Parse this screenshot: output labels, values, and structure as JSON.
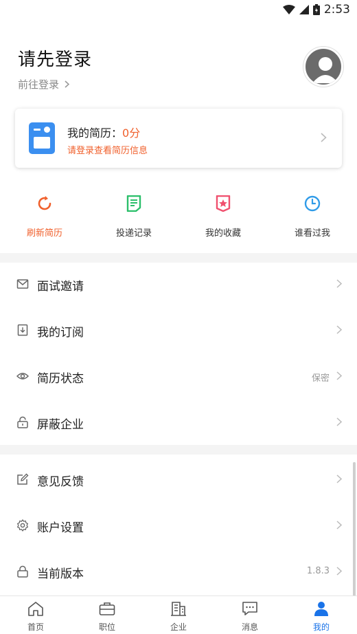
{
  "status": {
    "time": "2:53"
  },
  "profile": {
    "title": "请先登录",
    "login_link": "前往登录"
  },
  "resume": {
    "label": "我的简历：",
    "score": "0分",
    "hint": "请登录查看简历信息"
  },
  "quick_actions": [
    {
      "label": "刷新简历",
      "icon": "refresh-icon",
      "color": "#f0602c"
    },
    {
      "label": "投递记录",
      "icon": "document-icon",
      "color": "#2bbf6a"
    },
    {
      "label": "我的收藏",
      "icon": "bookmark-star-icon",
      "color": "#f0506e"
    },
    {
      "label": "谁看过我",
      "icon": "clock-icon",
      "color": "#2f9be8"
    }
  ],
  "menu_group1": [
    {
      "label": "面试邀请",
      "icon": "mail-icon",
      "value": ""
    },
    {
      "label": "我的订阅",
      "icon": "bookmark-icon",
      "value": ""
    },
    {
      "label": "简历状态",
      "icon": "eye-icon",
      "value": "保密"
    },
    {
      "label": "屏蔽企业",
      "icon": "unlock-icon",
      "value": ""
    }
  ],
  "menu_group2": [
    {
      "label": "意见反馈",
      "icon": "edit-icon",
      "value": ""
    },
    {
      "label": "账户设置",
      "icon": "gear-icon",
      "value": ""
    },
    {
      "label": "当前版本",
      "icon": "lock-icon",
      "value": "1.8.3"
    }
  ],
  "tabbar": [
    {
      "label": "首页",
      "icon": "home-icon"
    },
    {
      "label": "职位",
      "icon": "briefcase-icon"
    },
    {
      "label": "企业",
      "icon": "building-icon"
    },
    {
      "label": "消息",
      "icon": "message-icon"
    },
    {
      "label": "我的",
      "icon": "user-icon",
      "active": true
    }
  ],
  "colors": {
    "accent": "#f0602c",
    "active_tab": "#1a73e8",
    "resume_icon": "#3b8ff0"
  }
}
